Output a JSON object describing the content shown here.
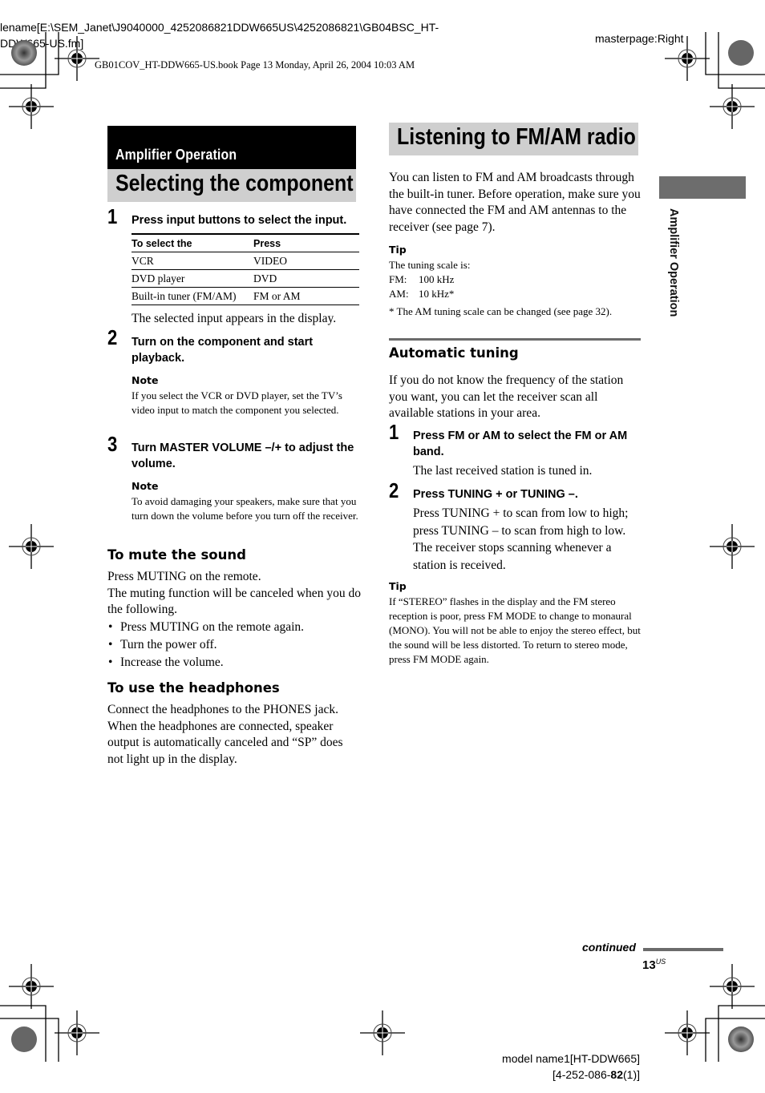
{
  "header": {
    "filename_line1": "lename[E:\\SEM_Janet\\J9040000_4252086821DDW665US\\4252086821\\GB04BSC_HT-",
    "filename_line2": "DDW665-US.fm]",
    "masterpage": "masterpage:Right",
    "book_info": "GB01COV_HT-DDW665-US.book  Page 13  Monday, April 26, 2004  10:03 AM"
  },
  "left": {
    "section_label": "Amplifier Operation",
    "title": "Selecting the component",
    "step1": {
      "num": "1",
      "text": "Press input buttons to select the input."
    },
    "table": {
      "headers": [
        "To select the",
        "Press"
      ],
      "rows": [
        [
          "VCR",
          "VIDEO"
        ],
        [
          "DVD player",
          "DVD"
        ],
        [
          "Built-in tuner (FM/AM)",
          "FM or AM"
        ]
      ]
    },
    "step1_result": "The selected input appears in the display.",
    "step2": {
      "num": "2",
      "text": "Turn on the component and start playback."
    },
    "note1": {
      "label": "Note",
      "text": "If you select the VCR or DVD player, set the TV’s video input to match the component you selected."
    },
    "step3": {
      "num": "3",
      "text": "Turn MASTER VOLUME –/+ to adjust the volume."
    },
    "note2": {
      "label": "Note",
      "text": "To avoid damaging your speakers, make sure that you turn down the volume before you turn off the receiver."
    },
    "mute": {
      "heading": "To mute the sound",
      "p1": "Press MUTING on the remote.",
      "p2": "The muting function will be canceled when you do the following.",
      "bullets": [
        "Press MUTING on the remote again.",
        "Turn the power off.",
        "Increase the volume."
      ]
    },
    "headphones": {
      "heading": "To use the headphones",
      "text": "Connect the headphones to the PHONES jack. When the headphones are connected, speaker output is automatically canceled and “SP” does not light up in the display."
    }
  },
  "right": {
    "title": "Listening to FM/AM radio",
    "intro": "You can listen to FM and AM broadcasts through the built-in tuner. Before operation, make sure you have connected the FM and AM antennas to the receiver (see page 7).",
    "tip1": {
      "label": "Tip",
      "line1": "The tuning scale is:",
      "fm_label": "FM:",
      "fm_value": "100 kHz",
      "am_label": "AM:",
      "am_value": "10 kHz*",
      "footnote": "* The AM tuning scale can be changed (see page 32)."
    },
    "auto": {
      "heading": "Automatic tuning",
      "intro": "If you do not know the frequency of the station you want, you can let the receiver scan all available stations in your area.",
      "step1": {
        "num": "1",
        "text": "Press FM or AM to select the FM or AM band.",
        "result": "The last received station is tuned in."
      },
      "step2": {
        "num": "2",
        "text": "Press TUNING + or TUNING –.",
        "result": "Press TUNING + to scan from low to high; press TUNING – to scan from high to low. The receiver stops scanning whenever a station is received."
      }
    },
    "tip2": {
      "label": "Tip",
      "text": "If “STEREO” flashes in the display and the FM stereo reception is poor, press FM MODE to change to monaural (MONO). You will not be able to enjoy the stereo effect, but the sound will be less distorted. To return to stereo mode, press FM MODE again."
    }
  },
  "side_tab": {
    "text": "Amplifier Operation"
  },
  "footer": {
    "continued": "continued",
    "page_number": "13",
    "page_suffix": "US",
    "model_line1": "model name1[HT-DDW665]",
    "model_line2_prefix": "[4-252-086-",
    "model_line2_bold": "82",
    "model_line2_suffix": "(1)]"
  }
}
